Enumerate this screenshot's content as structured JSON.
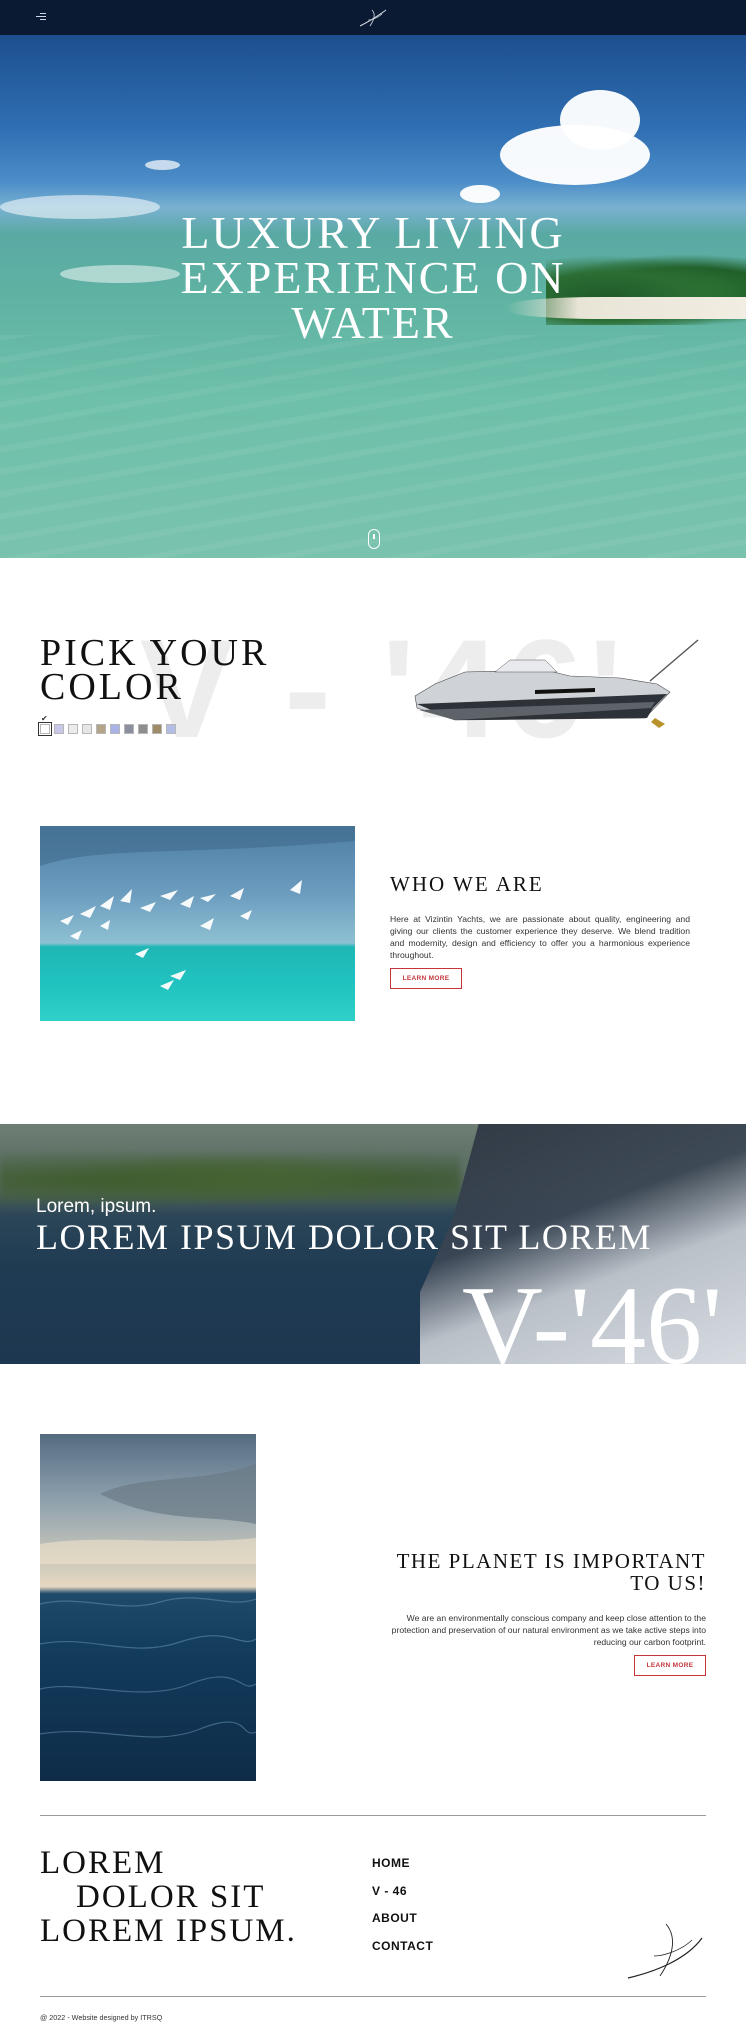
{
  "header": {
    "menu_icon": "menu-icon",
    "logo_icon": "signature-logo-icon",
    "background": "#0b1a33"
  },
  "hero": {
    "title_line1": "LUXURY LIVING",
    "title_line2": "EXPERIENCE ON",
    "title_line3": "WATER",
    "scroll_icon": "mouse-scroll-icon"
  },
  "pick_color": {
    "ghost_text": "V - '46'",
    "title_line1": "PICK YOUR",
    "title_line2": "COLOR",
    "check_mark": "✔",
    "swatches": [
      "#ffffff",
      "#c9c8e8",
      "#ececec",
      "#e6e6e6",
      "#b3a48a",
      "#a9b3e6",
      "#8c8fa0",
      "#8e8e8e",
      "#9d8b6a",
      "#b3bde6"
    ],
    "boat_image": "yacht-image"
  },
  "who_we_are": {
    "title": "WHO WE ARE",
    "text": "Here at Vizintin Yachts, we are passionate about quality, engineering and giving our clients the customer experience they deserve. We blend tradition and modernity, design and efficiency to offer you a harmonious experience throughout.",
    "button": "LEARN MORE",
    "accent": "#c4363a"
  },
  "banner": {
    "small": "Lorem, ipsum.",
    "big": "LOREM IPSUM DOLOR SIT LOREM",
    "model": "V-'46'"
  },
  "planet": {
    "title_line1": "THE PLANET IS IMPORTANT",
    "title_line2": "TO US!",
    "text": "We are an environmentally conscious company and keep close attention to the protection and preservation of our natural environment as we take active steps into reducing our carbon footprint.",
    "button": "LEARN MORE"
  },
  "footer": {
    "title_line1": "LOREM",
    "title_line2": "DOLOR SIT",
    "title_line3": "LOREM IPSUM.",
    "nav": [
      "HOME",
      "V - 46",
      "ABOUT",
      "CONTACT"
    ],
    "copyright": "@ 2022 - Website designed by ITRSQ"
  }
}
